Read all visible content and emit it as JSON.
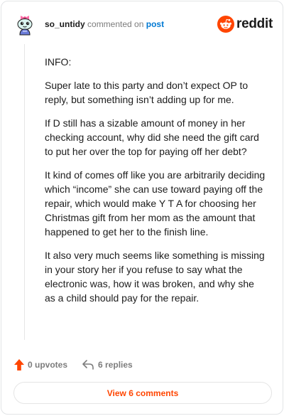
{
  "header": {
    "username": "so_untidy",
    "commented_text": "commented on",
    "post_link": "post",
    "brand": "reddit",
    "avatar_icon": "snoo-avatar-icon",
    "brand_icon": "reddit-logo-icon"
  },
  "comment": {
    "paragraphs": [
      "INFO:",
      "Super late to this party and don’t expect OP to reply, but something isn’t adding up for me.",
      "If D still has a sizable amount of money in her checking account, why did she need the gift card to put her over the top for paying off her debt?",
      "It kind of comes off like you are arbitrarily deciding which “income” she can use toward paying off the repair, which would make Y T A for choosing her Christmas gift from her mom as the amount that happened to get her to the finish line.",
      "It also very much seems like something is missing in your story her if you refuse to say what the electronic was, how it was broken, and why she as a child should pay for the repair."
    ]
  },
  "actions": {
    "upvotes": "0 upvotes",
    "replies": "6 replies",
    "upvote_icon": "upvote-arrow-icon",
    "reply_icon": "reply-arrow-icon"
  },
  "view_comments": "View 6 comments",
  "colors": {
    "accent": "#ff4500",
    "link": "#0079d3",
    "muted": "#7c7c7c",
    "text": "#1c1c1c"
  }
}
